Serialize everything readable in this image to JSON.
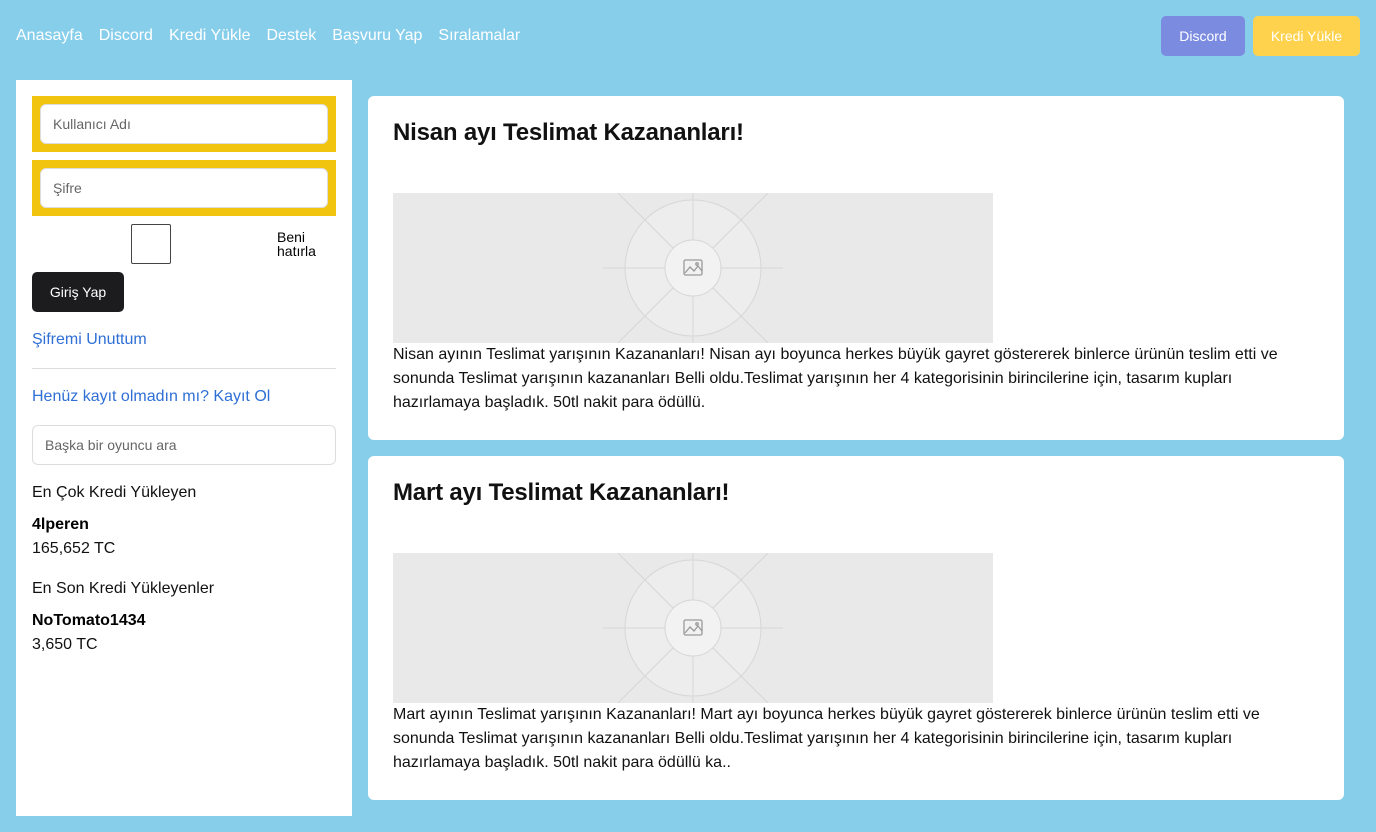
{
  "nav": {
    "links": [
      "Anasayfa",
      "Discord",
      "Kredi Yükle",
      "Destek",
      "Başvuru Yap",
      "Sıralamalar"
    ],
    "discord_button": "Discord",
    "kredi_button": "Kredi Yükle"
  },
  "login": {
    "username_placeholder": "Kullanıcı Adı",
    "password_placeholder": "Şifre",
    "remember_label": "Beni hatırla",
    "login_button": "Giriş Yap",
    "forgot_link": "Şifremi Unuttum",
    "register_link": "Henüz kayıt olmadın mı? Kayıt Ol"
  },
  "search": {
    "placeholder": "Başka bir oyuncu ara"
  },
  "top_loader": {
    "title": "En Çok Kredi Yükleyen",
    "name": "4lperen",
    "amount": "165,652 TC"
  },
  "recent_loader": {
    "title": "En Son Kredi Yükleyenler",
    "name": "NoTomato1434",
    "amount": "3,650 TC"
  },
  "posts": [
    {
      "title": "Nisan ayı Teslimat Kazananları!",
      "body": "Nisan ayının Teslimat yarışının Kazananları! Nisan ayı boyunca herkes büyük gayret göstererek binlerce ürünün teslim etti ve sonunda Teslimat yarışının kazananları Belli oldu.Teslimat yarışının her 4 kategorisinin birincilerine için, tasarım kupları hazırlamaya başladık. 50tl nakit para ödüllü."
    },
    {
      "title": "Mart ayı Teslimat Kazananları!",
      "body": "Mart ayının Teslimat yarışının Kazananları! Mart ayı boyunca herkes büyük gayret göstererek binlerce ürünün teslim etti ve sonunda Teslimat yarışının kazananları Belli oldu.Teslimat yarışının her 4 kategorisinin birincilerine için, tasarım kupları hazırlamaya başladık. 50tl nakit para ödüllü ka.."
    }
  ],
  "colors": {
    "background": "#87ceeb",
    "discord_button": "#7b8be0",
    "kredi_button": "#ffd24d",
    "input_frame": "#f1c40f",
    "link": "#2f6fd6"
  }
}
